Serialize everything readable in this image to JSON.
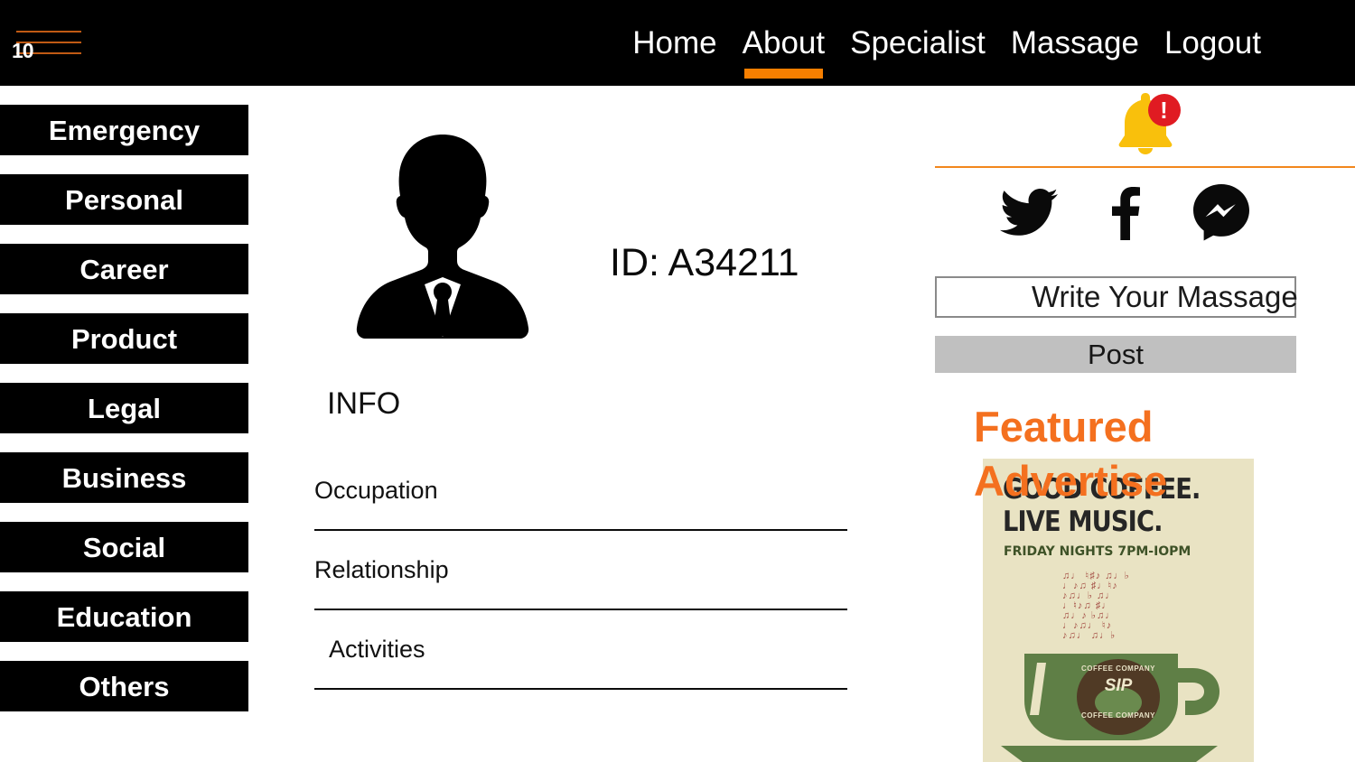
{
  "header": {
    "menu_icon": "hamburger-icon",
    "badge_count": "10",
    "nav": [
      {
        "label": "Home",
        "active": false
      },
      {
        "label": "About",
        "active": true
      },
      {
        "label": "Specialist",
        "active": false
      },
      {
        "label": "Massage",
        "active": false
      },
      {
        "label": "Logout",
        "active": false
      }
    ],
    "bg_color": "#000000",
    "accent_color": "#f77f00"
  },
  "sidebar": {
    "items": [
      {
        "label": "Emergency"
      },
      {
        "label": "Personal"
      },
      {
        "label": "Career"
      },
      {
        "label": "Product"
      },
      {
        "label": "Legal"
      },
      {
        "label": "Business"
      },
      {
        "label": "Social"
      },
      {
        "label": "Education"
      },
      {
        "label": "Others"
      }
    ],
    "bg_color": "#000000",
    "text_color": "#ffffff"
  },
  "profile": {
    "avatar_icon": "user-silhouette-icon",
    "id_text": "ID: A34211",
    "info_heading": "INFO",
    "fields": [
      {
        "name": "Occupation",
        "value": "",
        "indented": false
      },
      {
        "name": "Relationship",
        "value": "",
        "indented": false
      },
      {
        "name": "Activities",
        "value": "",
        "indented": true
      }
    ]
  },
  "right_panel": {
    "notification": {
      "icon": "bell-icon",
      "badge_symbol": "!",
      "bell_color": "#f9c00c",
      "badge_color": "#e01b22"
    },
    "divider_color": "#f2871d",
    "socials": [
      {
        "name": "twitter-icon",
        "label": "Twitter"
      },
      {
        "name": "facebook-icon",
        "label": "Facebook"
      },
      {
        "name": "messenger-icon",
        "label": "Messenger"
      }
    ],
    "message_input": {
      "value": "Write Your Massage",
      "placeholder": "Write Your Massage"
    },
    "post_button": {
      "label": "Post",
      "bg_color": "#c0c0c0"
    }
  },
  "featured": {
    "title": "Featured Advertise",
    "title_color": "#f4701f",
    "poster": {
      "headline_line1": "GOOD COFFEE.",
      "headline_line2": "LIVE MUSIC.",
      "subline": "FRIDAY NIGHTS  7PM-IOPM",
      "logo_top": "COFFEE COMPANY",
      "logo_center": "SIP",
      "logo_bottom": "COFFEE COMPANY",
      "bg_color": "#e9e3c3",
      "cup_color": "#5f7f46"
    }
  }
}
